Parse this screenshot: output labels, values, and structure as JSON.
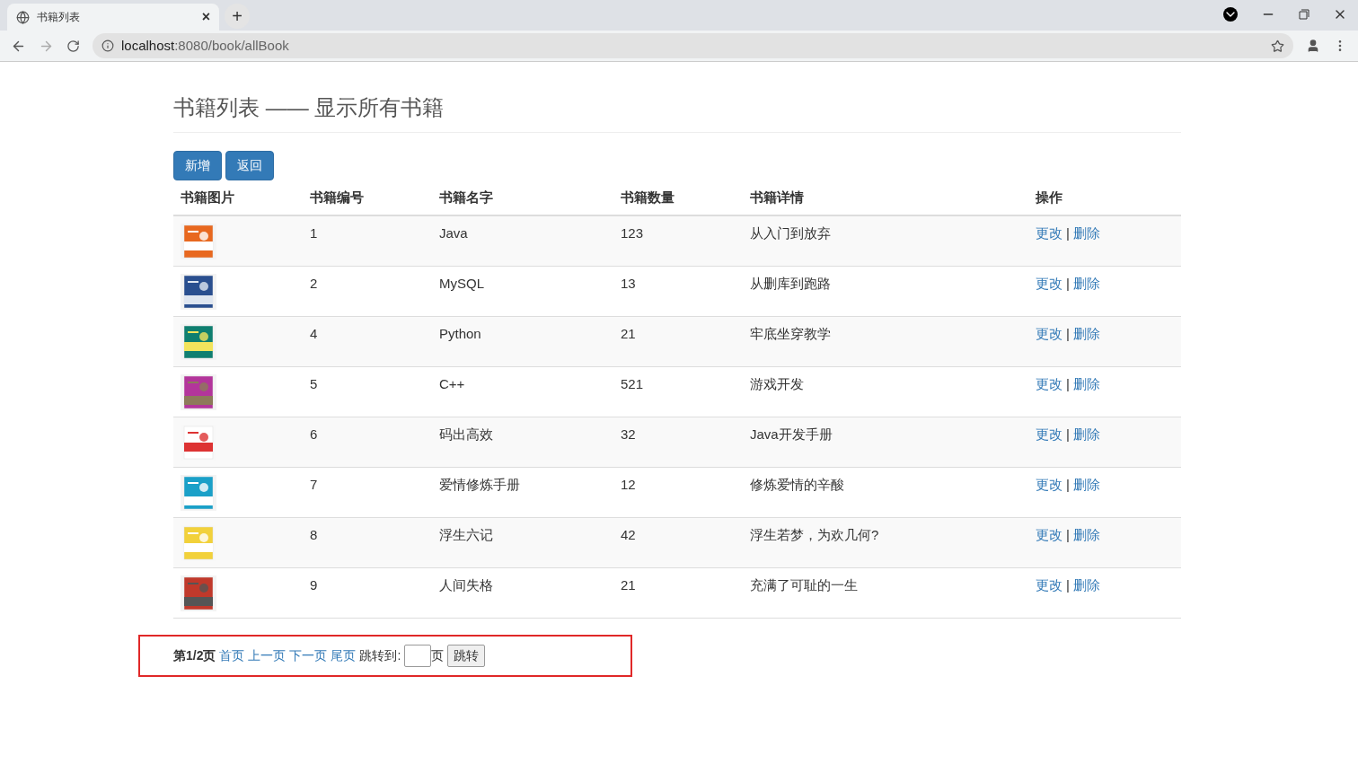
{
  "browser": {
    "tab": {
      "title": "书籍列表",
      "close": "×"
    },
    "new_tab": "+",
    "url": {
      "host": "localhost",
      "rest": ":8080/book/allBook"
    }
  },
  "page": {
    "title": "书籍列表 —— 显示所有书籍",
    "buttons": [
      "新增",
      "返回"
    ],
    "table": {
      "columns": [
        "书籍图片",
        "书籍编号",
        "书籍名字",
        "书籍数量",
        "书籍详情",
        "操作"
      ],
      "rows": [
        {
          "id": "1",
          "name": "Java",
          "count": "123",
          "detail": "从入门到放弃",
          "edit": "更改",
          "sep": "|",
          "delete": "删除"
        },
        {
          "id": "2",
          "name": "MySQL",
          "count": "13",
          "detail": "从删库到跑路",
          "edit": "更改",
          "sep": "|",
          "delete": "删除"
        },
        {
          "id": "4",
          "name": "Python",
          "count": "21",
          "detail": "牢底坐穿教学",
          "edit": "更改",
          "sep": "|",
          "delete": "删除"
        },
        {
          "id": "5",
          "name": "C++",
          "count": "521",
          "detail": "游戏开发",
          "edit": "更改",
          "sep": "|",
          "delete": "删除"
        },
        {
          "id": "6",
          "name": "码出高效",
          "count": "32",
          "detail": "Java开发手册",
          "edit": "更改",
          "sep": "|",
          "delete": "删除"
        },
        {
          "id": "7",
          "name": "爱情修炼手册",
          "count": "12",
          "detail": "修炼爱情的辛酸",
          "edit": "更改",
          "sep": "|",
          "delete": "删除"
        },
        {
          "id": "8",
          "name": "浮生六记",
          "count": "42",
          "detail": "浮生若梦，为欢几何?",
          "edit": "更改",
          "sep": "|",
          "delete": "删除"
        },
        {
          "id": "9",
          "name": "人间失格",
          "count": "21",
          "detail": "充满了可耻的一生",
          "edit": "更改",
          "sep": "|",
          "delete": "删除"
        }
      ]
    },
    "pagination": {
      "current": "第1/2页",
      "links": [
        "首页",
        "上一页",
        "下一页",
        "尾页"
      ],
      "jump_label": "跳转到:",
      "page_unit": "页",
      "jump_button": "跳转"
    }
  }
}
